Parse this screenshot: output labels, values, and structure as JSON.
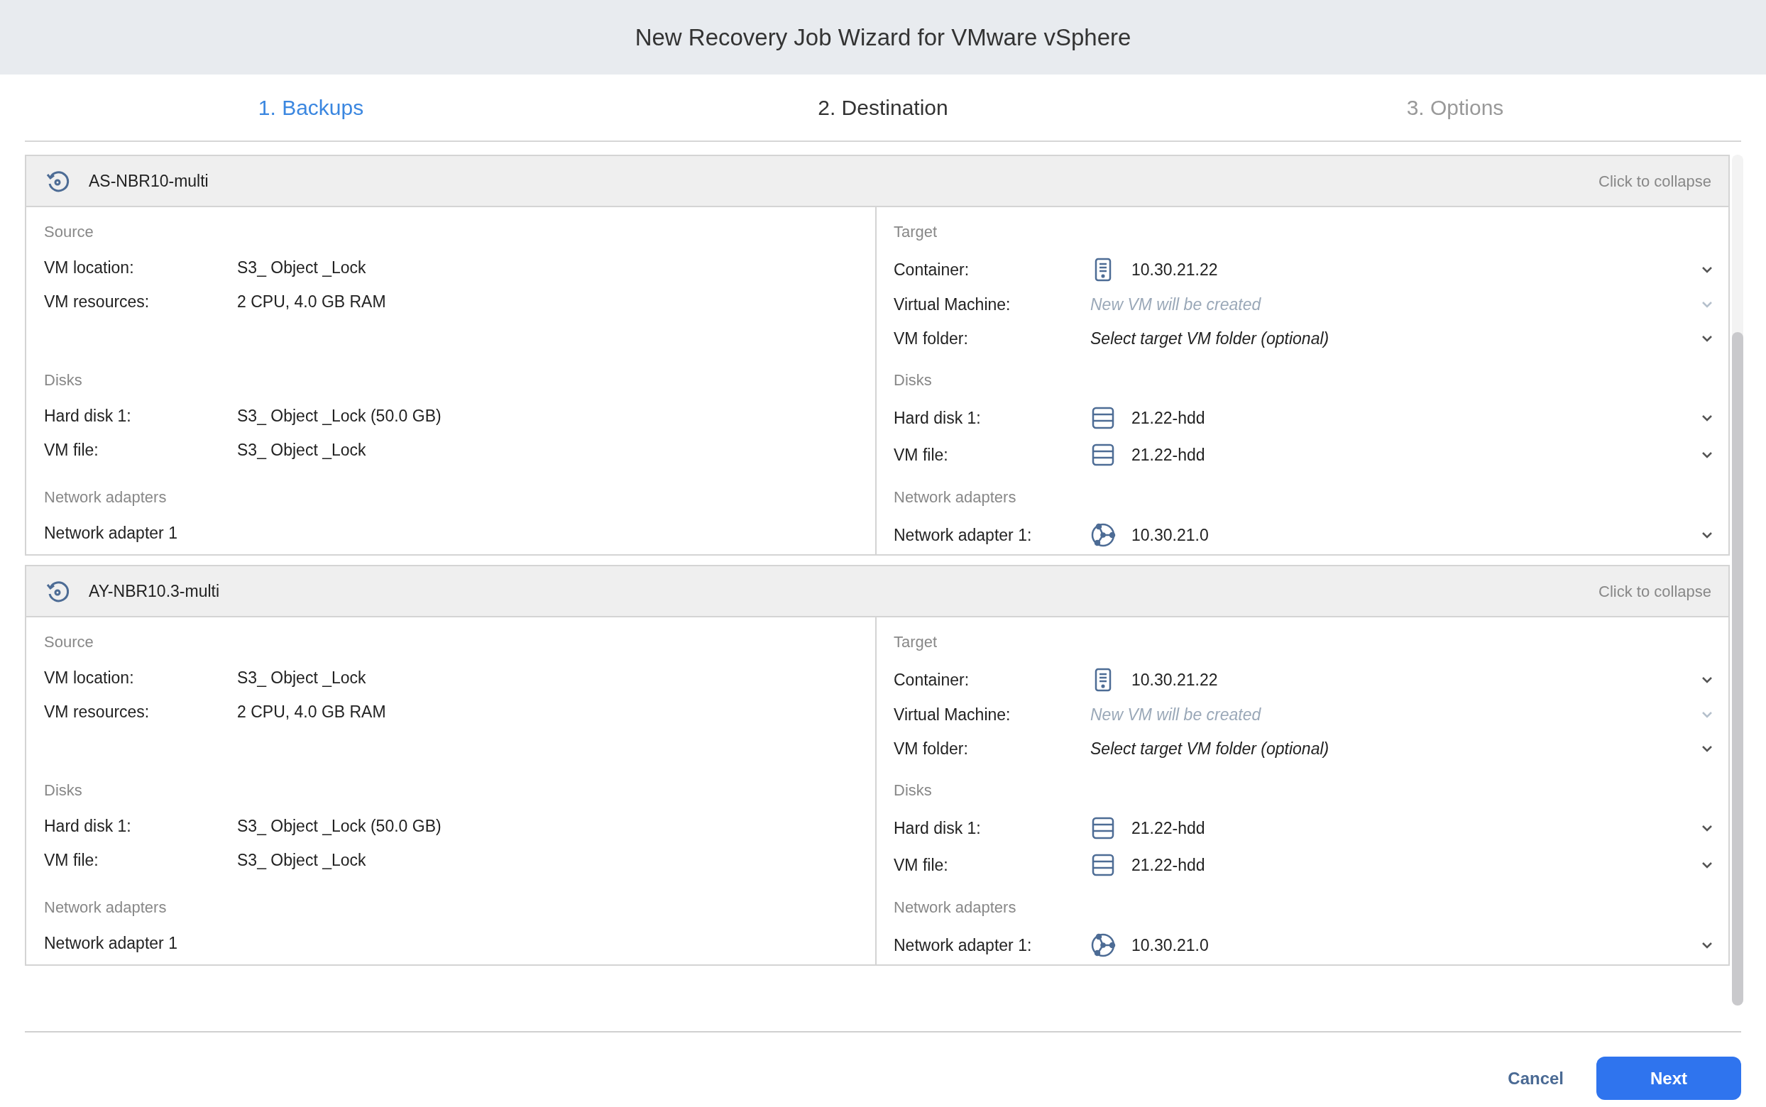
{
  "window": {
    "title": "New Recovery Job Wizard for VMware vSphere"
  },
  "steps": [
    {
      "label": "1. Backups",
      "selected": true,
      "disabled": false
    },
    {
      "label": "2. Destination",
      "selected": false,
      "disabled": false
    },
    {
      "label": "3. Options",
      "selected": false,
      "disabled": true
    }
  ],
  "backups": [
    {
      "name": "AS-NBR10-multi",
      "collapse_label": "Click to collapse",
      "sections": [
        {
          "source": {
            "heading": "Source",
            "rows": [
              {
                "label": "VM location:",
                "value": "S3_ Object _Lock"
              },
              {
                "label": "VM resources:",
                "value": "2 CPU, 4.0 GB RAM"
              }
            ]
          },
          "target": {
            "heading": "Target",
            "rows": [
              {
                "label": "Container:",
                "kind": "container",
                "value": "10.30.21.22",
                "disabled": false
              },
              {
                "label": "Virtual Machine:",
                "kind": "plain",
                "placeholder": "New VM will be created",
                "disabled": true
              },
              {
                "label": "VM folder:",
                "kind": "plain",
                "placeholder": "Select target VM folder (optional)",
                "disabled": false
              }
            ]
          }
        },
        {
          "source": {
            "heading": "Disks",
            "rows": [
              {
                "label": "Hard disk 1:",
                "value": "S3_ Object _Lock (50.0 GB)"
              },
              {
                "label": "VM file:",
                "value": "S3_ Object _Lock"
              }
            ]
          },
          "target": {
            "heading": "Disks",
            "rows": [
              {
                "label": "Hard disk 1:",
                "kind": "disk",
                "value": "21.22-hdd",
                "disabled": false
              },
              {
                "label": "VM file:",
                "kind": "disk",
                "value": "21.22-hdd",
                "disabled": false
              }
            ]
          }
        },
        {
          "source": {
            "heading": "Network adapters",
            "rows": [
              {
                "label": "Network adapter 1"
              }
            ]
          },
          "target": {
            "heading": "Network adapters",
            "rows": [
              {
                "label": "Network adapter 1:",
                "kind": "network",
                "value": "10.30.21.0",
                "disabled": false
              }
            ]
          }
        }
      ]
    },
    {
      "name": "AY-NBR10.3-multi",
      "collapse_label": "Click to collapse",
      "sections": [
        {
          "source": {
            "heading": "Source",
            "rows": [
              {
                "label": "VM location:",
                "value": "S3_ Object _Lock"
              },
              {
                "label": "VM resources:",
                "value": "2 CPU, 4.0 GB RAM"
              }
            ]
          },
          "target": {
            "heading": "Target",
            "rows": [
              {
                "label": "Container:",
                "kind": "container",
                "value": "10.30.21.22",
                "disabled": false
              },
              {
                "label": "Virtual Machine:",
                "kind": "plain",
                "placeholder": "New VM will be created",
                "disabled": true
              },
              {
                "label": "VM folder:",
                "kind": "plain",
                "placeholder": "Select target VM folder (optional)",
                "disabled": false
              }
            ]
          }
        },
        {
          "source": {
            "heading": "Disks",
            "rows": [
              {
                "label": "Hard disk 1:",
                "value": "S3_ Object _Lock (50.0 GB)"
              },
              {
                "label": "VM file:",
                "value": "S3_ Object _Lock"
              }
            ]
          },
          "target": {
            "heading": "Disks",
            "rows": [
              {
                "label": "Hard disk 1:",
                "kind": "disk",
                "value": "21.22-hdd",
                "disabled": false
              },
              {
                "label": "VM file:",
                "kind": "disk",
                "value": "21.22-hdd",
                "disabled": false
              }
            ]
          }
        },
        {
          "source": {
            "heading": "Network adapters",
            "rows": [
              {
                "label": "Network adapter 1"
              }
            ]
          },
          "target": {
            "heading": "Network adapters",
            "rows": [
              {
                "label": "Network adapter 1:",
                "kind": "network",
                "value": "10.30.21.0",
                "disabled": false
              }
            ]
          }
        }
      ]
    }
  ],
  "buttons": {
    "cancel": "Cancel",
    "next": "Next"
  }
}
